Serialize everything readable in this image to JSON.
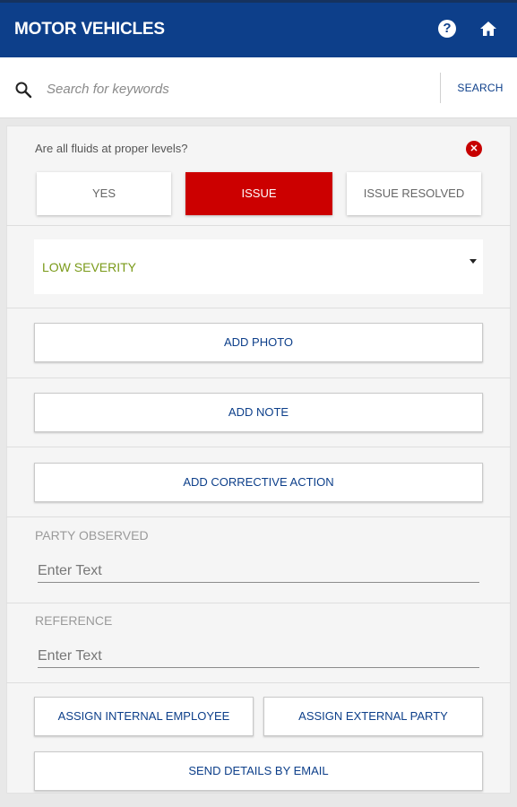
{
  "header": {
    "title": "MOTOR VEHICLES",
    "help_label": "?"
  },
  "search": {
    "placeholder": "Search for keywords",
    "button_label": "SEARCH"
  },
  "question": {
    "text": "Are all fluids at proper levels?",
    "close_glyph": "✕"
  },
  "options": [
    "YES",
    "ISSUE",
    "ISSUE RESOLVED"
  ],
  "selected_option": "ISSUE",
  "severity": {
    "value": "LOW SEVERITY"
  },
  "actions": {
    "add_photo": "ADD PHOTO",
    "add_note": "ADD NOTE",
    "add_corrective_action": "ADD CORRECTIVE ACTION"
  },
  "party_observed": {
    "label": "PARTY OBSERVED",
    "placeholder": "Enter Text"
  },
  "reference": {
    "label": "REFERENCE",
    "placeholder": "Enter Text"
  },
  "assign": {
    "internal": "ASSIGN INTERNAL EMPLOYEE",
    "external": "ASSIGN EXTERNAL PARTY",
    "email": "SEND DETAILS BY EMAIL"
  },
  "colors": {
    "header": "#0d3f8a",
    "issue_active": "#cc0000",
    "severity_text": "#7a9a19",
    "link_text": "#0d3f8a"
  },
  "icons": {
    "help": "help-circle-icon",
    "home": "home-icon",
    "search": "search-icon",
    "close": "close-circle-icon",
    "dropdown": "caret-down-icon"
  }
}
